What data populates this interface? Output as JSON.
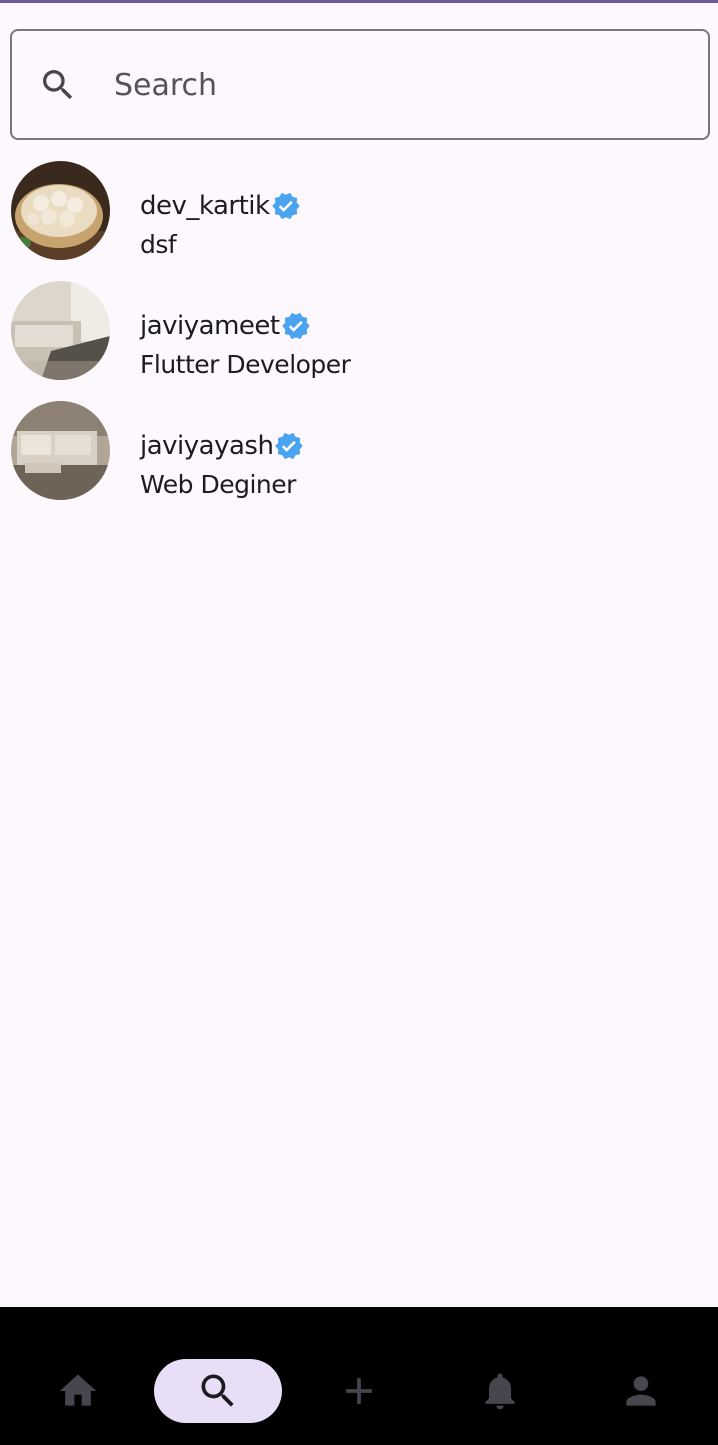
{
  "search": {
    "placeholder": "Search",
    "value": ""
  },
  "users": [
    {
      "username": "dev_kartik",
      "bio": "dsf",
      "verified": true,
      "avatar": "dumplings-photo"
    },
    {
      "username": "javiyameet",
      "bio": "Flutter Developer",
      "verified": true,
      "avatar": "living-room-photo"
    },
    {
      "username": "javiyayash",
      "bio": "Web Deginer",
      "verified": true,
      "avatar": "sofa-room-photo"
    }
  ],
  "bottom_nav": {
    "items": [
      {
        "icon": "home-icon",
        "active": false
      },
      {
        "icon": "search-icon",
        "active": true
      },
      {
        "icon": "add-icon",
        "active": false
      },
      {
        "icon": "notifications-icon",
        "active": false
      },
      {
        "icon": "profile-icon",
        "active": false
      }
    ]
  },
  "colors": {
    "background": "#fdf8fd",
    "verified_badge": "#4aa3ef",
    "nav_background": "#000000",
    "nav_active_pill": "#e8def8",
    "nav_icon": "#49454f",
    "top_accent": "#6f5a9e"
  }
}
